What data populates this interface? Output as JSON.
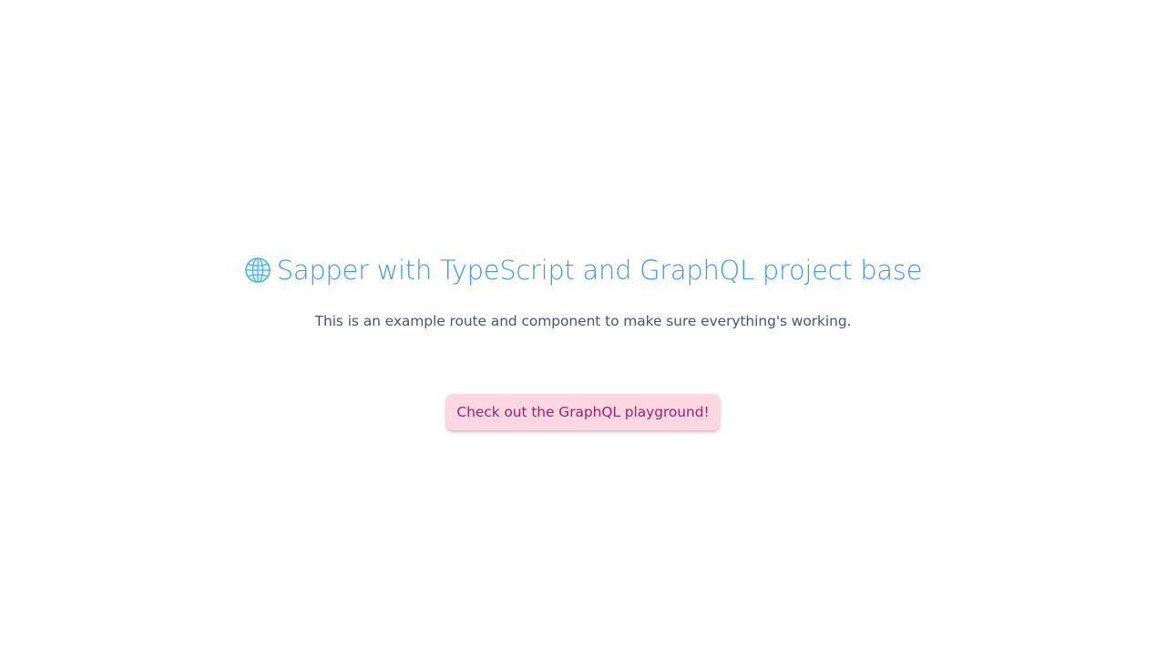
{
  "hero": {
    "icon": "globe-icon",
    "title": "Sapper with TypeScript and GraphQL project base",
    "subtitle": "This is an example route and component to make sure everything's working."
  },
  "cta": {
    "label": "Check out the GraphQL playground!"
  },
  "colors": {
    "title": "#4299e1",
    "subtitle": "#4a5568",
    "cta_background": "#fed7e2",
    "cta_text": "#97266d",
    "globe": "#4fb3d9"
  }
}
